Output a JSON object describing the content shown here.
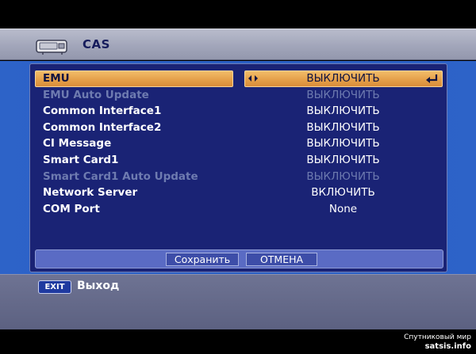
{
  "header": {
    "title": "CAS",
    "icon": "cas-module-icon"
  },
  "menu": {
    "rows": [
      {
        "label": "EMU",
        "value": "ВЫКЛЮЧИТЬ",
        "state": "selected"
      },
      {
        "label": "EMU Auto Update",
        "value": "ВЫКЛЮЧИТЬ",
        "state": "disabled"
      },
      {
        "label": "Common Interface1",
        "value": "ВЫКЛЮЧИТЬ",
        "state": "normal"
      },
      {
        "label": "Common Interface2",
        "value": "ВЫКЛЮЧИТЬ",
        "state": "normal"
      },
      {
        "label": "CI Message",
        "value": "ВЫКЛЮЧИТЬ",
        "state": "normal"
      },
      {
        "label": "Smart Card1",
        "value": "ВЫКЛЮЧИТЬ",
        "state": "normal"
      },
      {
        "label": "Smart Card1 Auto Update",
        "value": "ВЫКЛЮЧИТЬ",
        "state": "disabled"
      },
      {
        "label": "Network Server",
        "value": "ВКЛЮЧИТЬ",
        "state": "normal"
      },
      {
        "label": "COM Port",
        "value": "None",
        "state": "normal"
      }
    ]
  },
  "buttons": {
    "save": "Сохранить",
    "cancel": "ОТМЕНА"
  },
  "footer": {
    "exit_key": "EXIT",
    "exit_label": "Выход"
  },
  "watermark": {
    "line1": "Спутниковый мир",
    "line2": "satsis.info"
  },
  "colors": {
    "highlight": "#e5a04a",
    "panel": "#1a2375",
    "band": "#2d63c8",
    "disabled_text": "#6e7bb0"
  }
}
